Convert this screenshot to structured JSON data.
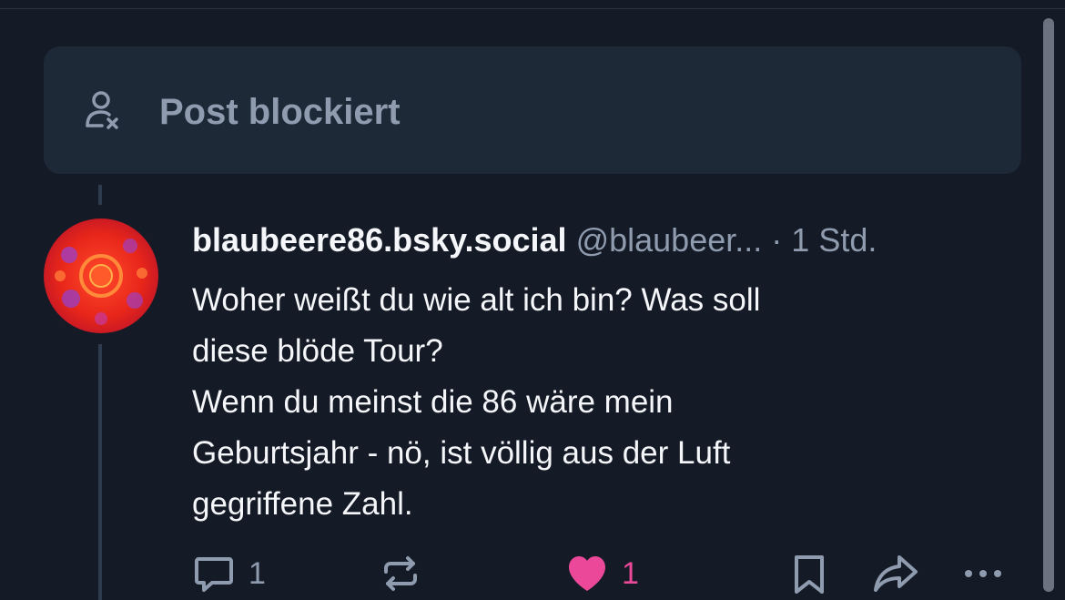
{
  "blocked_notice": {
    "label": "Post blockiert",
    "icon": "person-x-icon"
  },
  "post": {
    "display_name": "blaubeere86.bsky.social",
    "handle": "@blaubeer...",
    "separator": "·",
    "time": "1 Std.",
    "body": [
      "Woher weißt du wie alt ich bin? Was soll",
      "diese blöde Tour?",
      "Wenn du meinst die 86 wäre mein",
      "Geburtsjahr - nö, ist völlig aus der Luft",
      "gegriffene Zahl."
    ],
    "avatar_icon": "avatar-image"
  },
  "actions": {
    "reply": {
      "icon": "reply-icon",
      "count": "1"
    },
    "repost": {
      "icon": "repost-icon"
    },
    "like": {
      "icon": "heart-icon",
      "count": "1",
      "liked": true
    },
    "bookmark": {
      "icon": "bookmark-icon"
    },
    "share": {
      "icon": "share-icon"
    },
    "more": {
      "icon": "more-icon"
    }
  },
  "colors": {
    "background": "#151b26",
    "card": "#1e2938",
    "text": "#f4f6f9",
    "muted": "#8f9bae",
    "like": "#ec4899"
  }
}
